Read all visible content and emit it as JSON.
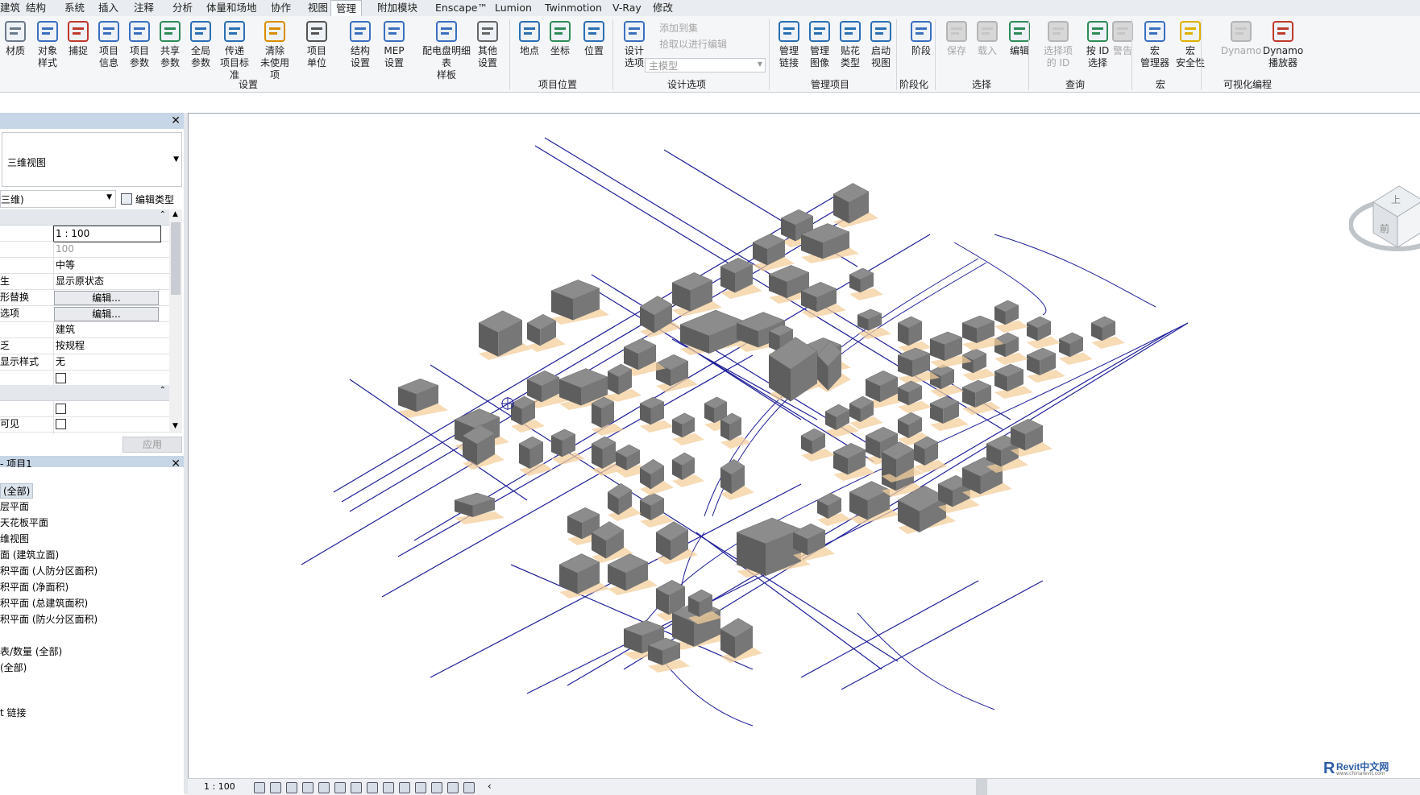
{
  "menu": {
    "tabs": [
      "建筑",
      "结构",
      "系统",
      "插入",
      "注释",
      "分析",
      "体量和场地",
      "协作",
      "视图",
      "管理",
      "附加模块",
      "Enscape™",
      "Lumion",
      "Twinmotion",
      "V-Ray",
      "修改"
    ],
    "active_tab": "管理"
  },
  "ribbon": {
    "buttons": [
      {
        "l1": "材质",
        "l2": "",
        "name": "materials-button"
      },
      {
        "l1": "对象",
        "l2": "样式",
        "name": "object-styles-button"
      },
      {
        "l1": "捕捉",
        "l2": "",
        "name": "snaps-button"
      },
      {
        "l1": "项目",
        "l2": "信息",
        "name": "project-info-button"
      },
      {
        "l1": "项目",
        "l2": "参数",
        "name": "project-parameters-button"
      },
      {
        "l1": "共享",
        "l2": "参数",
        "name": "shared-parameters-button"
      },
      {
        "l1": "全局",
        "l2": "参数",
        "name": "global-parameters-button"
      },
      {
        "l1": "传递",
        "l2": "项目标准",
        "name": "transfer-standards-button"
      },
      {
        "l1": "清除",
        "l2": "未使用项",
        "name": "purge-unused-button"
      },
      {
        "l1": "项目",
        "l2": "单位",
        "name": "project-units-button"
      },
      {
        "l1": "结构",
        "l2": "设置",
        "name": "structural-settings-button"
      },
      {
        "l1": "MEP",
        "l2": "设置",
        "name": "mep-settings-button"
      },
      {
        "l1": "配电盘明细表",
        "l2": "样板",
        "name": "panel-schedule-button"
      },
      {
        "l1": "其他",
        "l2": "设置",
        "name": "additional-settings-button"
      },
      {
        "l1": "地点",
        "l2": "",
        "name": "location-button"
      },
      {
        "l1": "坐标",
        "l2": "",
        "name": "coordinates-button"
      },
      {
        "l1": "位置",
        "l2": "",
        "name": "position-button"
      },
      {
        "l1": "设计",
        "l2": "选项",
        "name": "design-options-button"
      },
      {
        "l1": "管理",
        "l2": "链接",
        "name": "manage-links-button"
      },
      {
        "l1": "管理",
        "l2": "图像",
        "name": "manage-images-button"
      },
      {
        "l1": "贴花",
        "l2": "类型",
        "name": "decal-types-button"
      },
      {
        "l1": "启动",
        "l2": "视图",
        "name": "starting-view-button"
      },
      {
        "l1": "阶段",
        "l2": "",
        "name": "phases-button"
      },
      {
        "l1": "保存",
        "l2": "",
        "name": "save-selection-button"
      },
      {
        "l1": "载入",
        "l2": "",
        "name": "load-selection-button"
      },
      {
        "l1": "编辑",
        "l2": "",
        "name": "edit-selection-button"
      },
      {
        "l1": "选择项",
        "l2": "的 ID",
        "name": "ids-of-selection-button"
      },
      {
        "l1": "按 ID",
        "l2": "选择",
        "name": "select-by-id-button"
      },
      {
        "l1": "警告",
        "l2": "",
        "name": "warnings-button"
      },
      {
        "l1": "宏",
        "l2": "管理器",
        "name": "macro-manager-button"
      },
      {
        "l1": "宏",
        "l2": "安全性",
        "name": "macro-security-button"
      },
      {
        "l1": "Dynamo",
        "l2": "",
        "name": "dynamo-button"
      },
      {
        "l1": "Dynamo",
        "l2": "播放器",
        "name": "dynamo-player-button"
      }
    ],
    "small": {
      "add_to_set": "添加到集",
      "pick_to_edit": "拾取以进行编辑",
      "main_model": "主模型"
    },
    "groups": {
      "settings": "设置",
      "project_location": "项目位置",
      "design_options": "设计选项",
      "manage_project": "管理项目",
      "phasing": "阶段化",
      "selection": "选择",
      "inquiry": "查询",
      "macros": "宏",
      "visual_programming": "可视化编程"
    }
  },
  "properties": {
    "type_selector": "三维视图",
    "view_selector": "三维)",
    "edit_type": "编辑类型",
    "rows": [
      {
        "label": "",
        "value": "1 : 100"
      },
      {
        "label": "",
        "value": "100"
      },
      {
        "label": "",
        "value": "中等"
      },
      {
        "label": "生",
        "value": "显示原状态"
      },
      {
        "label": "形替换",
        "value": "编辑..."
      },
      {
        "label": "选项",
        "value": "编辑..."
      },
      {
        "label": "",
        "value": "建筑"
      },
      {
        "label": "乏",
        "value": "按规程"
      },
      {
        "label": "显示样式",
        "value": "无"
      }
    ],
    "row_visible": "可见",
    "apply": "应用"
  },
  "browser": {
    "title": "- 项目1",
    "items": [
      "(全部)",
      "层平面",
      "天花板平面",
      "维视图",
      "面 (建筑立面)",
      "积平面 (人防分区面积)",
      "积平面 (净面积)",
      "积平面 (总建筑面积)",
      "积平面 (防火分区面积)",
      "表/数量 (全部)",
      "(全部)",
      "t 链接"
    ]
  },
  "status": {
    "scale": "1 : 100"
  },
  "viewcube": {
    "top": "上",
    "front": "前"
  },
  "watermark": {
    "brand": "Revit中文网",
    "url": "www.chinarevit.com"
  },
  "colors": {
    "accent": "#1a3a8c",
    "building": "#6e6e6e",
    "shadow": "#f3cf9c",
    "line": "#1f1f9a"
  }
}
